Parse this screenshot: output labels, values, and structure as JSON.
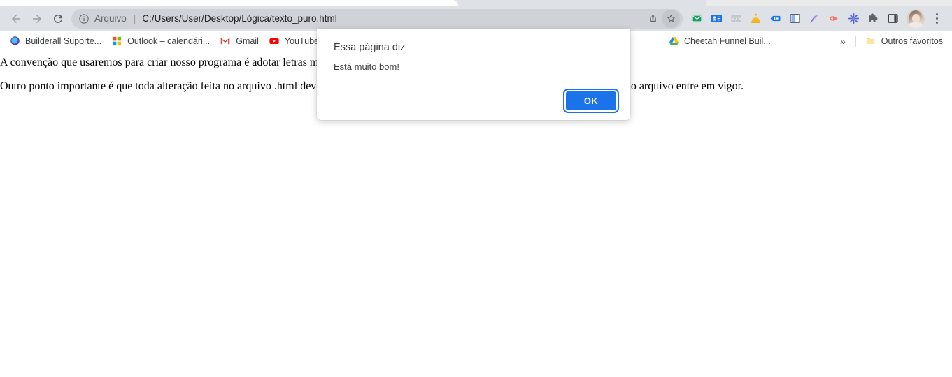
{
  "browser": {
    "nav": {
      "back_label": "Back",
      "forward_label": "Forward",
      "reload_label": "Reload"
    },
    "omnibox": {
      "info_icon": "info-circle-icon",
      "scheme_label": "Arquivo",
      "separator": "|",
      "url": "C:/Users/User/Desktop/Lógica/texto_puro.html",
      "share_icon": "share-icon",
      "bookmark_icon": "star-icon"
    },
    "extensions": [
      {
        "name": "mail-extension-icon",
        "title": "Mail"
      },
      {
        "name": "contact-card-extension-icon",
        "title": "Contacts"
      },
      {
        "name": "code-brackets-extension-icon",
        "title": "Code"
      },
      {
        "name": "honey-extension-icon",
        "title": "Honey"
      },
      {
        "name": "blue-tag-extension-icon",
        "title": "Tag"
      },
      {
        "name": "clipboard-copy-extension-icon",
        "title": "Copy"
      },
      {
        "name": "purple-feather-extension-icon",
        "title": "Feather"
      },
      {
        "name": "red-play-extension-icon",
        "title": "Play"
      },
      {
        "name": "blue-asterisk-extension-icon",
        "title": "Asterisk"
      },
      {
        "name": "puzzle-piece-icon",
        "title": "Extensions"
      },
      {
        "name": "side-panel-icon",
        "title": "Side panel"
      }
    ],
    "profile": {
      "avatar_name": "profile-avatar"
    },
    "menu": {
      "name": "chrome-menu-kebab",
      "label": "Personalizar e controlar o Google Chrome"
    }
  },
  "bookmarks": {
    "items": [
      {
        "label": "Builderall Suporte...",
        "icon": "builderall-favicon"
      },
      {
        "label": "Outlook – calendári...",
        "icon": "outlook-favicon"
      },
      {
        "label": "Gmail",
        "icon": "gmail-favicon"
      },
      {
        "label": "YouTube",
        "icon": "youtube-favicon"
      },
      {
        "label": "Cheetah Funnel Buil...",
        "icon": "google-drive-favicon"
      }
    ],
    "overflow_label": "»",
    "other_label": "Outros favoritos",
    "other_icon": "folder-icon"
  },
  "page": {
    "paragraphs": [
      "A convenção que usaremos para criar nosso programa é adotar letras minúsculas.",
      "Outro ponto importante é que toda alteração feita no arquivo .html deve ser salva e a página deve ser atualizada para que a última alteração do arquivo entre em vigor."
    ]
  },
  "dialog": {
    "title": "Essa página diz",
    "message": "Está muito bom!",
    "ok_label": "OK"
  },
  "colors": {
    "chrome_toolbar": "#dee1e6",
    "omnibox": "#cfd3d8",
    "accent_blue": "#1a73e8",
    "text_primary": "#202124",
    "text_secondary": "#5f6368"
  }
}
